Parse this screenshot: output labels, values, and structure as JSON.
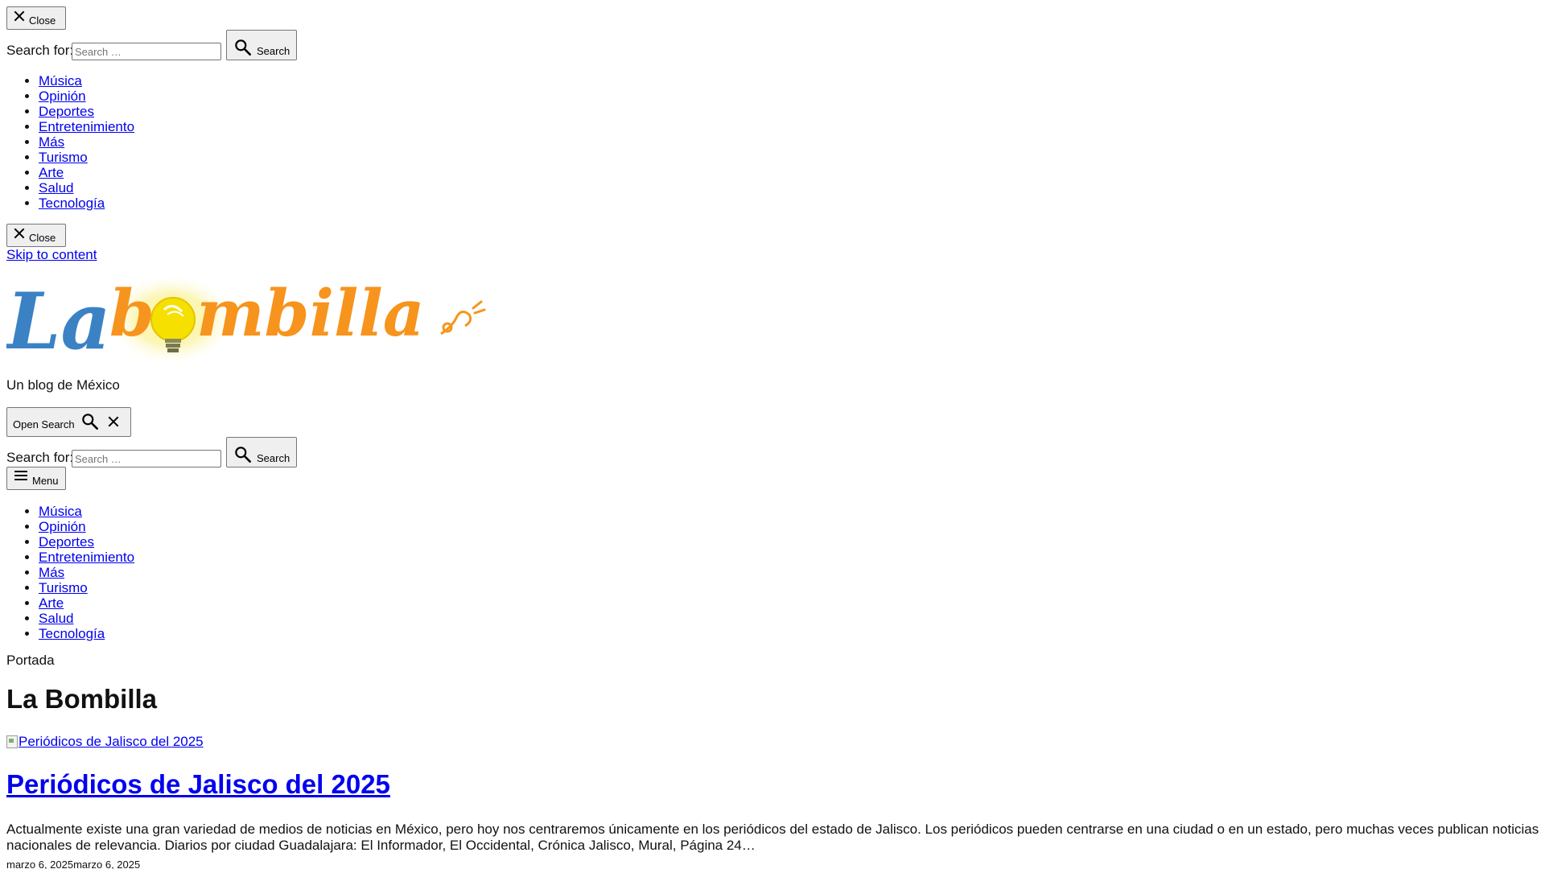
{
  "modal": {
    "close_label": "Close",
    "search_label": "Search for:",
    "search_placeholder": "Search …",
    "search_button_label": "Search",
    "nav_items": [
      "Música",
      "Opinión",
      "Deportes",
      "Entretenimiento",
      "Más",
      "Turismo",
      "Arte",
      "Salud",
      "Tecnología"
    ],
    "close_label_2": "Close"
  },
  "skip_link": "Skip to content",
  "site": {
    "logo_text": "La bombilla",
    "tagline": "Un blog de México",
    "colors": {
      "logo_la": "#3b82c4",
      "logo_bombilla": "#f7941d",
      "bulb": "#f6e000"
    }
  },
  "header": {
    "open_search_label": "Open Search",
    "search_label": "Search for:",
    "search_placeholder": "Search …",
    "search_button_label": "Search",
    "menu_label": "Menu",
    "nav_items": [
      "Música",
      "Opinión",
      "Deportes",
      "Entretenimiento",
      "Más",
      "Turismo",
      "Arte",
      "Salud",
      "Tecnología"
    ]
  },
  "main": {
    "breadcrumb": "Portada",
    "page_title": "La Bombilla",
    "post": {
      "image_alt": "Periódicos de Jalisco del 2025",
      "title": "Periódicos de Jalisco del 2025",
      "excerpt": "Actualmente existe una gran variedad de medios de noticias en México, pero hoy nos centraremos únicamente en los periódicos del estado de Jalisco. Los periódicos pueden centrarse en una ciudad o en un estado, pero muchas veces publican noticias nacionales de relevancia. Diarios por ciudad Guadalajara: El Informador, El Occidental, Crónica Jalisco, Mural, Página 24…",
      "date": "marzo 6, 2025marzo 6, 2025"
    }
  }
}
